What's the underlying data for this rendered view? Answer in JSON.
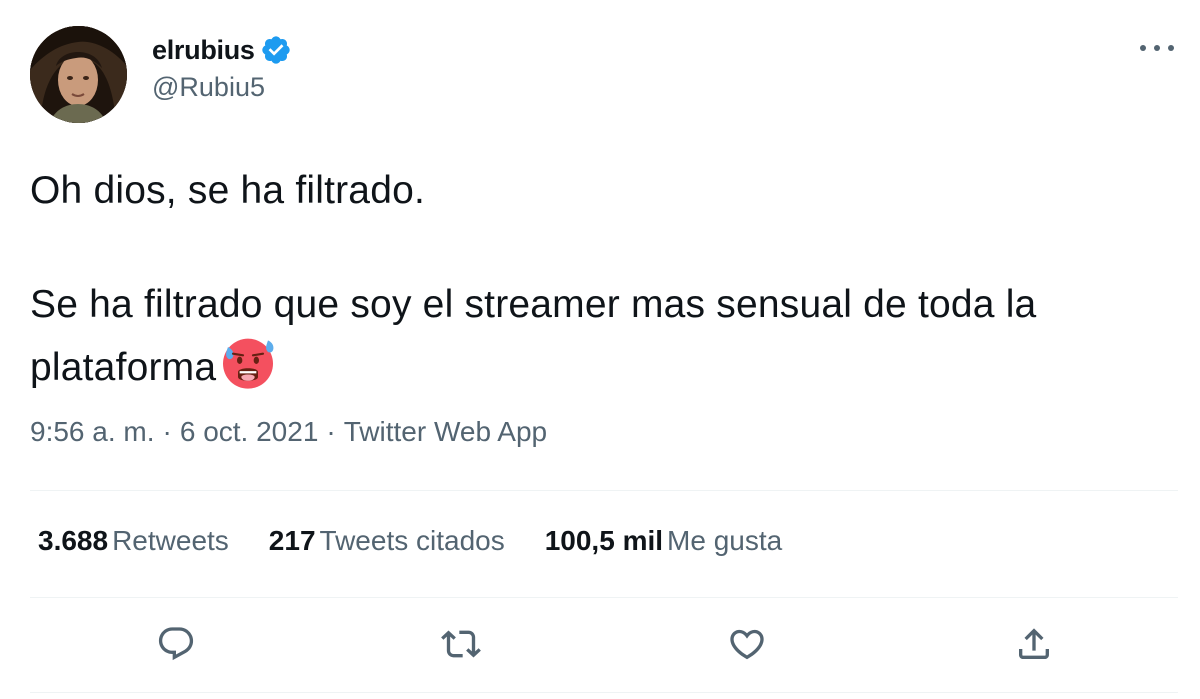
{
  "author": {
    "display_name": "elrubius",
    "handle": "@Rubiu5",
    "verified": true,
    "avatar_icon": "profile-photo",
    "verified_icon": "verified-badge-icon",
    "verified_color": "#1d9bf0"
  },
  "menu": {
    "more_icon": "more-options-icon"
  },
  "tweet": {
    "line1": "Oh dios, se ha filtrado.",
    "line2": "Se ha filtrado que soy el streamer mas sensual de toda la plataforma",
    "emoji": "hot-sweating-face-emoji"
  },
  "meta": {
    "time": "9:56 a. m.",
    "sep1": "·",
    "date": "6 oct. 2021",
    "sep2": "·",
    "source": "Twitter Web App"
  },
  "stats": {
    "retweets_count": "3.688",
    "retweets_label": "Retweets",
    "quotes_count": "217",
    "quotes_label": "Tweets citados",
    "likes_count": "100,5 mil",
    "likes_label": "Me gusta"
  },
  "actions": {
    "reply_icon": "reply-icon",
    "retweet_icon": "retweet-icon",
    "like_icon": "heart-icon",
    "share_icon": "share-icon",
    "icon_color": "#536471"
  },
  "colors": {
    "text": "#0f1419",
    "secondary": "#536471",
    "divider": "#eff3f4"
  }
}
